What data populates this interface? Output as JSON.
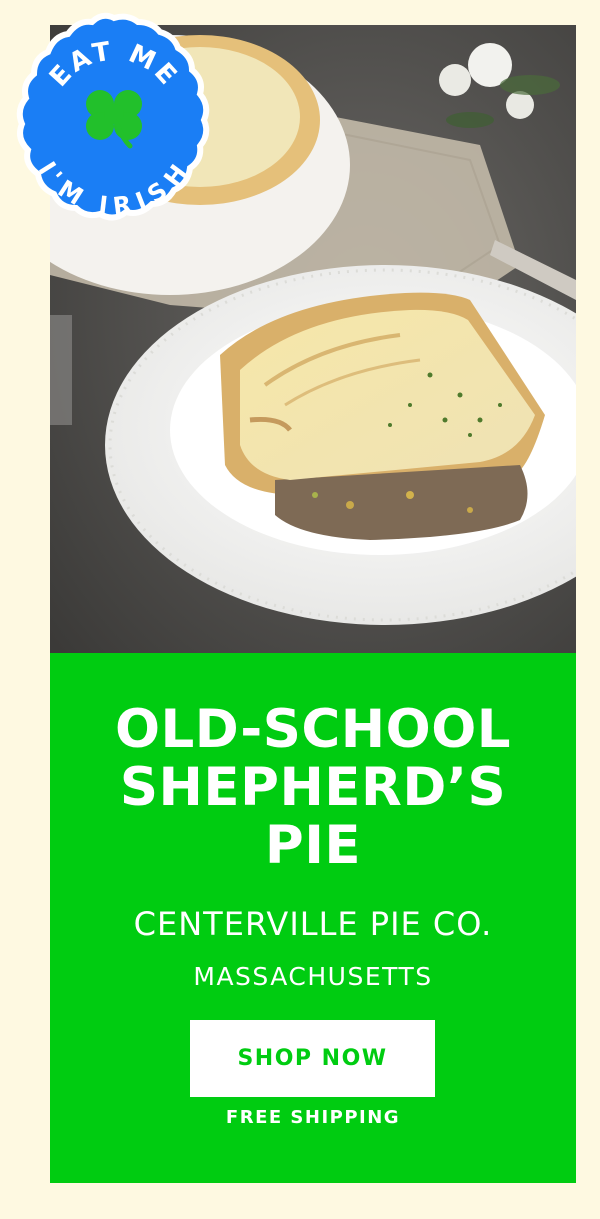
{
  "badge": {
    "top_text": "EAT ME",
    "bottom_text": "I'M IRISH",
    "icon": "shamrock-icon",
    "color": "#1a7ef5"
  },
  "hero": {
    "image": "shepherds-pie-slice-photo"
  },
  "promo": {
    "title_lines": [
      "OLD-SCHOOL",
      "SHEPHERD’S",
      "PIE"
    ],
    "company": "CENTERVILLE PIE CO.",
    "state": "MASSACHUSETTS",
    "cta_label": "SHOP NOW",
    "shipping_note": "FREE SHIPPING",
    "accent_color": "#00cc11"
  }
}
